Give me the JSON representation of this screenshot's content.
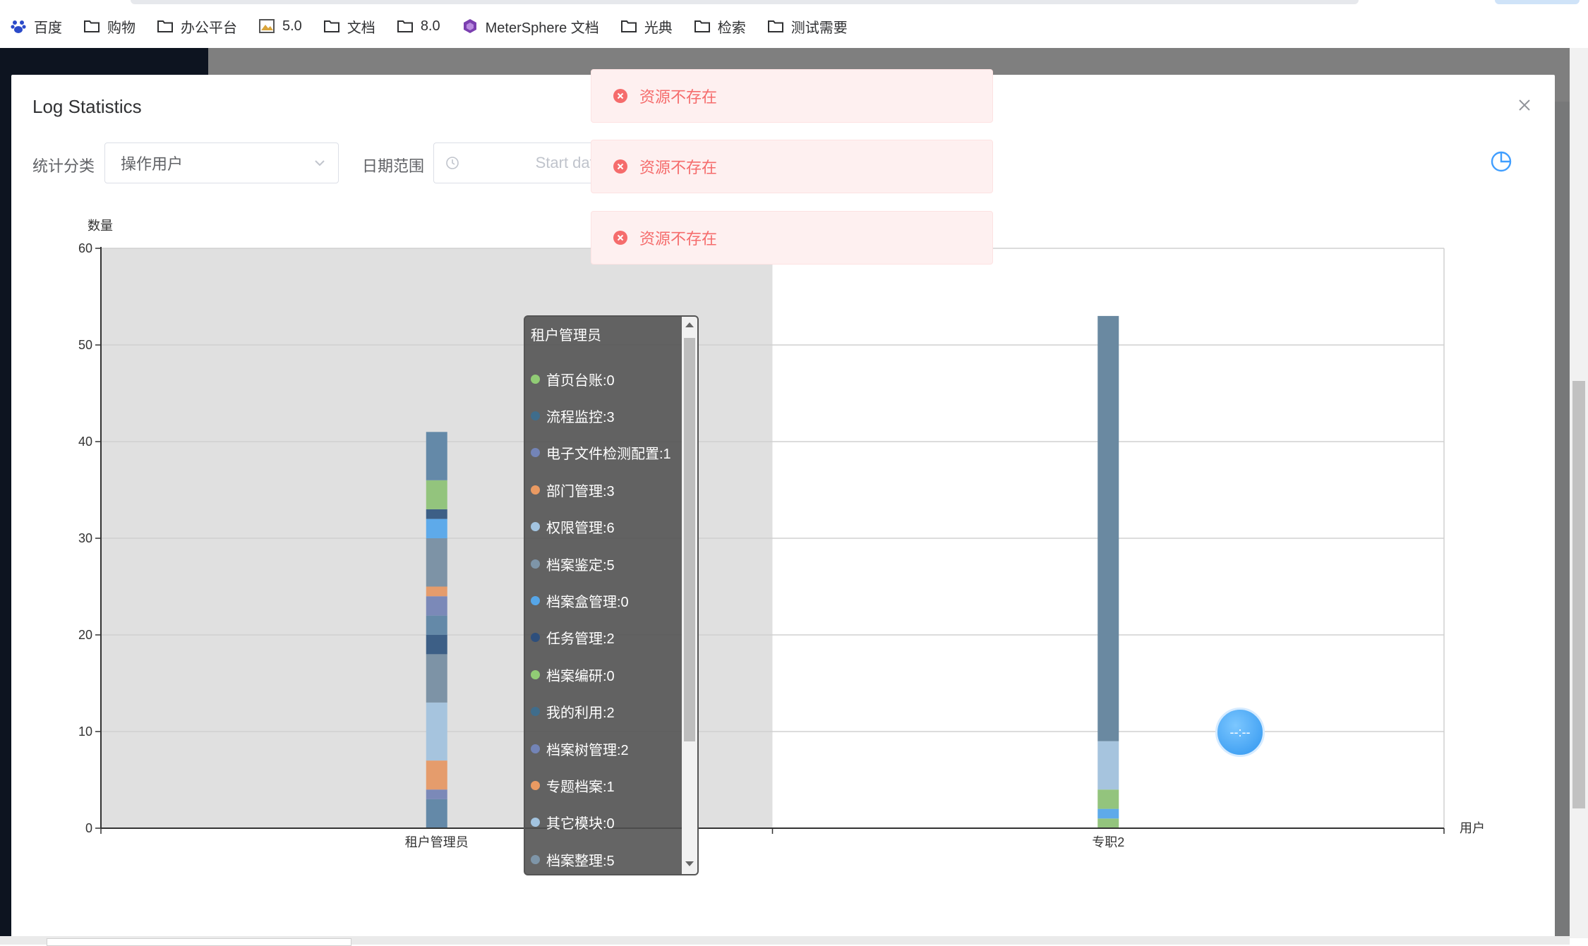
{
  "bookmarks": [
    {
      "label": "百度",
      "icon": "baidu-paw-icon"
    },
    {
      "label": "购物",
      "icon": "folder-icon"
    },
    {
      "label": "办公平台",
      "icon": "folder-icon"
    },
    {
      "label": "5.0",
      "icon": "image-icon"
    },
    {
      "label": "文档",
      "icon": "folder-icon"
    },
    {
      "label": "8.0",
      "icon": "folder-icon"
    },
    {
      "label": "MeterSphere 文档",
      "icon": "metersphere-cube-icon"
    },
    {
      "label": "光典",
      "icon": "folder-icon"
    },
    {
      "label": "检索",
      "icon": "folder-icon"
    },
    {
      "label": "测试需要",
      "icon": "folder-icon"
    }
  ],
  "dialog": {
    "title": "Log Statistics",
    "filters": {
      "category_label": "统计分类",
      "category_value": "操作用户",
      "date_label": "日期范围",
      "date_placeholder": "Start date"
    }
  },
  "toasts": [
    {
      "message": "资源不存在"
    },
    {
      "message": "资源不存在"
    },
    {
      "message": "资源不存在"
    }
  ],
  "tooltip": {
    "title": "租户管理员",
    "items": [
      {
        "label": "首页台账:0",
        "color": "#91cc75"
      },
      {
        "label": "流程监控:3",
        "color": "#3f6d8c"
      },
      {
        "label": "电子文件检测配置:1",
        "color": "#7384b7"
      },
      {
        "label": "部门管理:3",
        "color": "#ea9a62"
      },
      {
        "label": "权限管理:6",
        "color": "#a3c4e0"
      },
      {
        "label": "档案鉴定:5",
        "color": "#7e95a8"
      },
      {
        "label": "档案盒管理:0",
        "color": "#56a6e8"
      },
      {
        "label": "任务管理:2",
        "color": "#2e4f7c"
      },
      {
        "label": "档案编研:0",
        "color": "#91cc75"
      },
      {
        "label": "我的利用:2",
        "color": "#3f6d8c"
      },
      {
        "label": "档案树管理:2",
        "color": "#7384b7"
      },
      {
        "label": "专题档案:1",
        "color": "#ea9a62"
      },
      {
        "label": "其它模块:0",
        "color": "#a3c4e0"
      },
      {
        "label": "档案整理:5",
        "color": "#7e95a8"
      }
    ]
  },
  "float_button": {
    "label": "--:--"
  },
  "chart_data": {
    "type": "bar",
    "stacked": true,
    "categories": [
      "租户管理员",
      "专职2"
    ],
    "ylabel": "数量",
    "xlabel": "用户",
    "ylim": [
      0,
      60
    ],
    "yticks": [
      0,
      10,
      20,
      30,
      40,
      50,
      60
    ],
    "highlighted_category": "租户管理员",
    "stacks": [
      [
        {
          "value": 3,
          "color": "#6489a8"
        },
        {
          "value": 1,
          "color": "#7b89b8"
        },
        {
          "value": 3,
          "color": "#e59c6c"
        },
        {
          "value": 6,
          "color": "#a6c4de"
        },
        {
          "value": 5,
          "color": "#7d93a6"
        },
        {
          "value": 2,
          "color": "#3d5f86"
        },
        {
          "value": 2,
          "color": "#6489a8"
        },
        {
          "value": 2,
          "color": "#7b89b8"
        },
        {
          "value": 1,
          "color": "#e59c6c"
        },
        {
          "value": 5,
          "color": "#7d93a6"
        },
        {
          "value": 2,
          "color": "#5eaaea"
        },
        {
          "value": 1,
          "color": "#3d5f86"
        },
        {
          "value": 3,
          "color": "#93c47d"
        },
        {
          "value": 5,
          "color": "#6489a8"
        }
      ],
      [
        {
          "value": 1,
          "color": "#93c47d"
        },
        {
          "value": 1,
          "color": "#5eaaea"
        },
        {
          "value": 2,
          "color": "#93c47d"
        },
        {
          "value": 5,
          "color": "#a6c4de"
        },
        {
          "value": 44,
          "color": "#6a89a1"
        }
      ]
    ]
  }
}
